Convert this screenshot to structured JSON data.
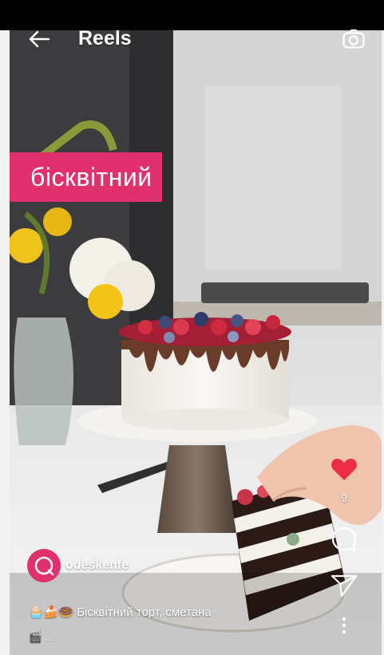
{
  "header": {
    "title": "Reels",
    "back_icon": "arrow-left-icon",
    "camera_icon": "camera-icon"
  },
  "reel": {
    "caption_tag": "бісквітний",
    "likes": "9",
    "author": "odeskenfe",
    "description_line1": "🧁🍰🍩 Бісквітний торт, сметана",
    "description_line2": "🎬 ...",
    "like_icon": "heart-icon",
    "comment_icon": "comment-icon",
    "share_icon": "paper-plane-icon",
    "more_icon": "more-vertical-icon"
  },
  "colors": {
    "accent": "#e0306e",
    "like": "#ed2d48",
    "overlay_text": "#ffffff"
  }
}
